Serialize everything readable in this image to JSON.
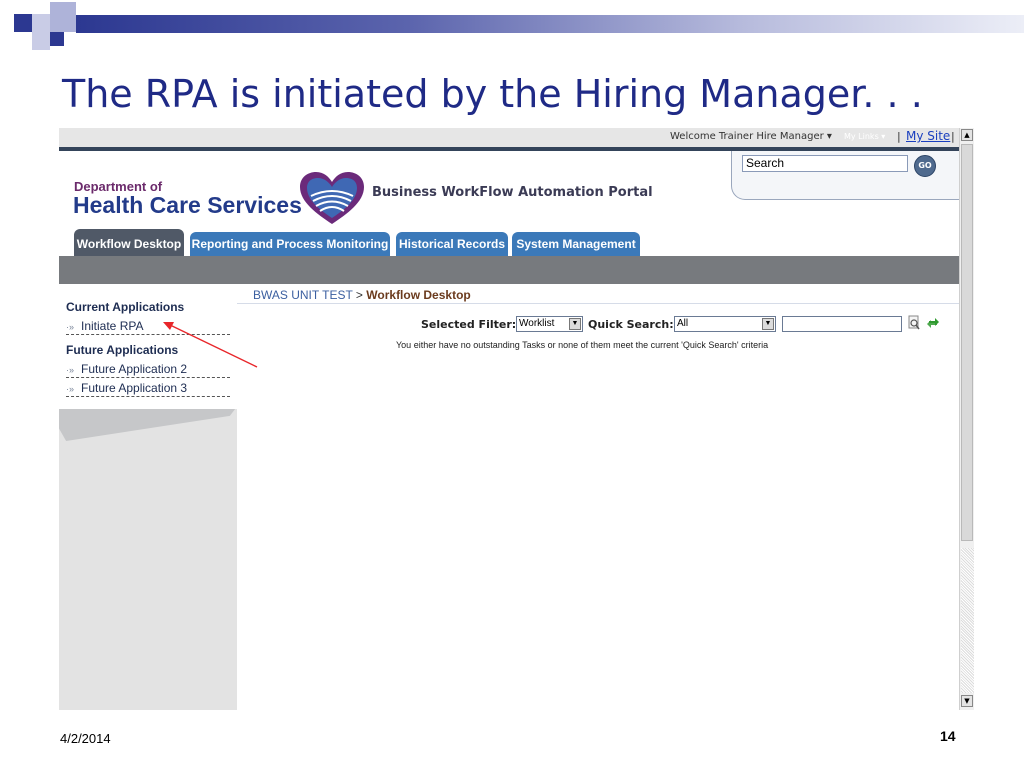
{
  "slide": {
    "title": "The RPA is initiated by the Hiring Manager. . .",
    "date": "4/2/2014",
    "page_number": "14"
  },
  "topbar": {
    "welcome": "Welcome Trainer Hire Manager ▾",
    "my_links": "My Links ▾",
    "separator": "|",
    "my_site": "My Site"
  },
  "search": {
    "value": "Search",
    "go_label": "GO"
  },
  "branding": {
    "dept_line1": "Department of",
    "dept_line2": "Health Care Services",
    "portal_title": "Business WorkFlow Automation Portal"
  },
  "tabs": [
    {
      "label": "Workflow Desktop",
      "active": true
    },
    {
      "label": "Reporting and Process Monitoring",
      "active": false
    },
    {
      "label": "Historical Records",
      "active": false
    },
    {
      "label": "System Management",
      "active": false
    }
  ],
  "sidebar": {
    "current_heading": "Current Applications",
    "future_heading": "Future Applications",
    "links": [
      {
        "label": "Initiate RPA"
      },
      {
        "label": "Future Application 2"
      },
      {
        "label": "Future Application 3"
      }
    ],
    "arrow_glyph": "·»"
  },
  "content": {
    "breadcrumb_root": "BWAS UNIT TEST",
    "breadcrumb_sep": ">",
    "breadcrumb_current": "Workflow Desktop",
    "selected_filter_label": "Selected Filter:",
    "selected_filter_value": "Worklist",
    "quick_search_label": "Quick Search:",
    "quick_search_value": "All",
    "message": "You either have no outstanding Tasks or none of them meet the current 'Quick Search' criteria"
  },
  "colors": {
    "title_blue": "#1f2a86",
    "tab_blue": "#3b79b9",
    "tab_active": "#505967",
    "annotation_arrow": "#e8262a"
  }
}
